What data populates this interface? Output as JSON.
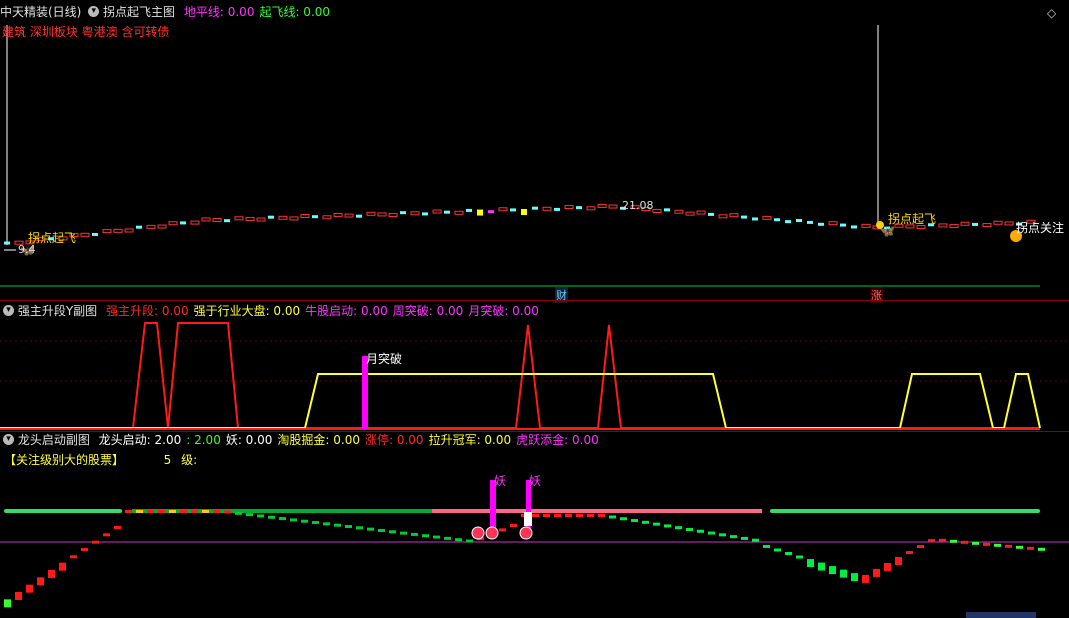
{
  "main_panel": {
    "title": "中天精装(日线)",
    "indicator_name": "拐点起飞主图",
    "fields": [
      {
        "label": "地平线:",
        "value": "0.00",
        "color": "#ff33ff"
      },
      {
        "label": "起飞线:",
        "value": "0.00",
        "color": "#33ff33"
      }
    ],
    "concepts": "建筑 深圳板块 粤港澳 含可转债",
    "price_label": "21.08",
    "left_price_label": "9.4",
    "signal_left": "拐点起飞",
    "signal_right": "拐点起飞",
    "watch_label": "拐点关注",
    "marker_cai": "财",
    "marker_zhang": "涨",
    "diamond_icon": "diamond-icon"
  },
  "sub1": {
    "indicator_name": "强主升段Y副图",
    "fields": [
      {
        "label": "强主升段:",
        "value": "0.00",
        "color": "#ff2a2a"
      },
      {
        "label": "强于行业大盘:",
        "value": "0.00",
        "color": "#ffff33"
      },
      {
        "label": "牛股启动:",
        "value": "0.00",
        "color": "#ff33ff"
      },
      {
        "label": "周突破:",
        "value": "0.00",
        "color": "#ff33ff"
      },
      {
        "label": "月突破:",
        "value": "0.00",
        "color": "#ff33ff"
      }
    ],
    "annotation": "月突破"
  },
  "sub2": {
    "indicator_name": "龙头启动副图",
    "fields": [
      {
        "label": "龙头启动:",
        "value": "2.00",
        "color": "#ffffff"
      },
      {
        "label": ":",
        "value": "2.00",
        "color": "#33ff33"
      },
      {
        "label": "妖:",
        "value": "0.00",
        "color": "#ffffff"
      },
      {
        "label": "淘股掘金:",
        "value": "0.00",
        "color": "#ffff33"
      },
      {
        "label": "涨停:",
        "value": "0.00",
        "color": "#ff2a2a"
      },
      {
        "label": "拉升冠军:",
        "value": "0.00",
        "color": "#ffff33"
      },
      {
        "label": "虎跃添金:",
        "value": "0.00",
        "color": "#ff33ff"
      }
    ],
    "focus_label": "【关注级别大的股票】",
    "level_value": "5",
    "level_unit": "级:",
    "yao_label_1": "妖",
    "yao_label_2": "妖"
  }
}
